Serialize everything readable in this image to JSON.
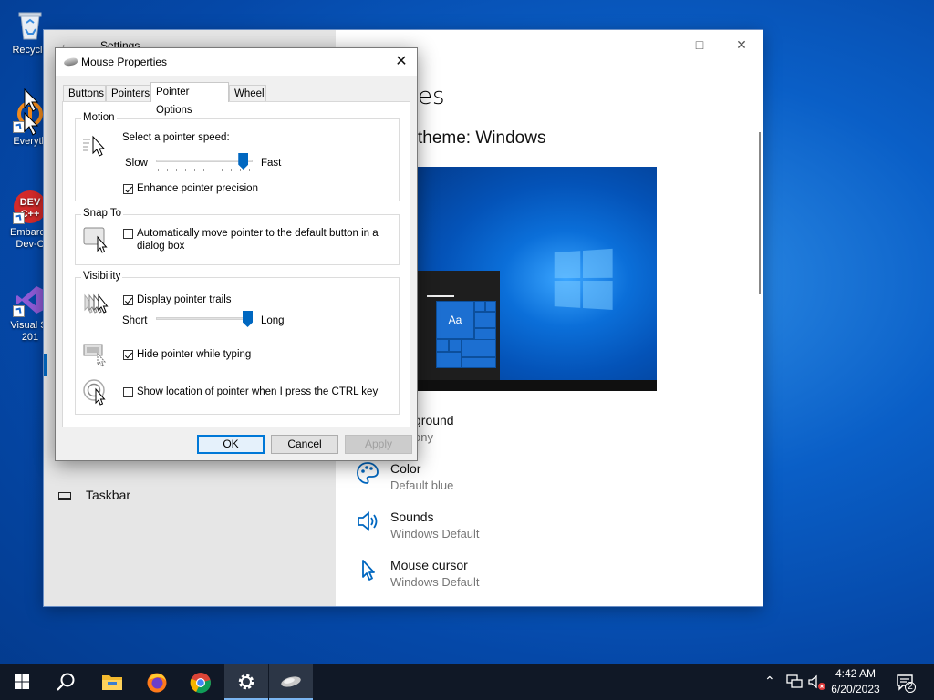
{
  "desktop": {
    "icons": [
      {
        "name": "recycle-bin",
        "label": "Recycle"
      },
      {
        "name": "everything",
        "label": "Everyth"
      },
      {
        "name": "embarcadero-dev-cpp",
        "label": "Embarca Dev-C",
        "logo_text": "DEV C++"
      },
      {
        "name": "visual-studio",
        "label": "Visual St 201"
      }
    ]
  },
  "settings": {
    "title": "Settings",
    "heading": "es",
    "current_theme": "theme: Windows",
    "nav": {
      "taskbar_label": "Taskbar"
    },
    "items": [
      {
        "title": "ground",
        "subtitle": "ony"
      },
      {
        "title": "Color",
        "subtitle": "Default blue"
      },
      {
        "title": "Sounds",
        "subtitle": "Windows Default"
      },
      {
        "title": "Mouse cursor",
        "subtitle": "Windows Default"
      }
    ],
    "preview_tile_text": "Aa"
  },
  "dialog": {
    "title": "Mouse Properties",
    "tabs": [
      "Buttons",
      "Pointers",
      "Pointer Options",
      "Wheel"
    ],
    "active_tab": "Pointer Options",
    "motion": {
      "group_title": "Motion",
      "speed_label": "Select a pointer speed:",
      "slow_label": "Slow",
      "fast_label": "Fast",
      "speed_value_fraction": 0.95,
      "enhance_precision_label": "Enhance pointer precision",
      "enhance_precision_checked": true
    },
    "snap_to": {
      "group_title": "Snap To",
      "auto_move_label_line1": "Automatically move pointer to the default button in a",
      "auto_move_label_line2": "dialog box",
      "auto_move_checked": false
    },
    "visibility": {
      "group_title": "Visibility",
      "trails_label": "Display pointer trails",
      "trails_checked": true,
      "short_label": "Short",
      "long_label": "Long",
      "trail_length_fraction": 1.0,
      "hide_typing_label": "Hide pointer while typing",
      "hide_typing_checked": true,
      "show_location_label": "Show location of pointer when I press the CTRL key",
      "show_location_checked": false
    },
    "buttons": {
      "ok": "OK",
      "cancel": "Cancel",
      "apply": "Apply"
    }
  },
  "taskbar": {
    "apps": [
      "start",
      "search",
      "file-explorer",
      "firefox",
      "chrome",
      "settings",
      "mouse-properties"
    ],
    "time": "4:42 AM",
    "date": "6/20/2023",
    "notification_count": "2"
  },
  "colors": {
    "accent": "#0067c0",
    "desktop": "#0a5fc7",
    "taskbar": "#101826"
  }
}
